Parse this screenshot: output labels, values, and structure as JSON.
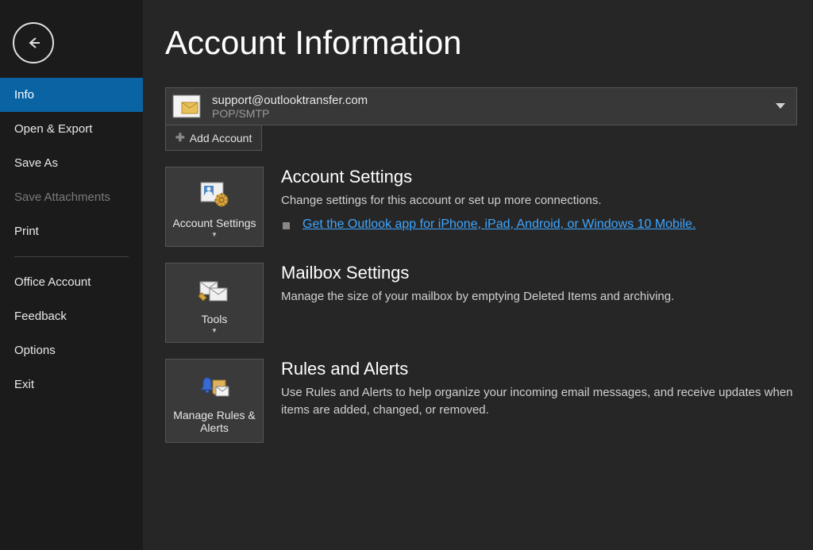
{
  "sidebar": {
    "items": [
      {
        "label": "Info",
        "selected": true
      },
      {
        "label": "Open & Export"
      },
      {
        "label": "Save As"
      },
      {
        "label": "Save Attachments",
        "disabled": true
      },
      {
        "label": "Print"
      }
    ],
    "bottomItems": [
      {
        "label": "Office Account"
      },
      {
        "label": "Feedback"
      },
      {
        "label": "Options"
      },
      {
        "label": "Exit"
      }
    ]
  },
  "page": {
    "title": "Account Information"
  },
  "account": {
    "email": "support@outlooktransfer.com",
    "protocol": "POP/SMTP",
    "addButtonLabel": "Add Account"
  },
  "sections": {
    "accountSettings": {
      "buttonLabel": "Account Settings",
      "title": "Account Settings",
      "description": "Change settings for this account or set up more connections.",
      "link": "Get the Outlook app for iPhone, iPad, Android, or Windows 10 Mobile."
    },
    "mailbox": {
      "buttonLabel": "Tools",
      "title": "Mailbox Settings",
      "description": "Manage the size of your mailbox by emptying Deleted Items and archiving."
    },
    "rules": {
      "buttonLabel": "Manage Rules & Alerts",
      "title": "Rules and Alerts",
      "description": "Use Rules and Alerts to help organize your incoming email messages, and receive updates when items are added, changed, or removed."
    }
  }
}
